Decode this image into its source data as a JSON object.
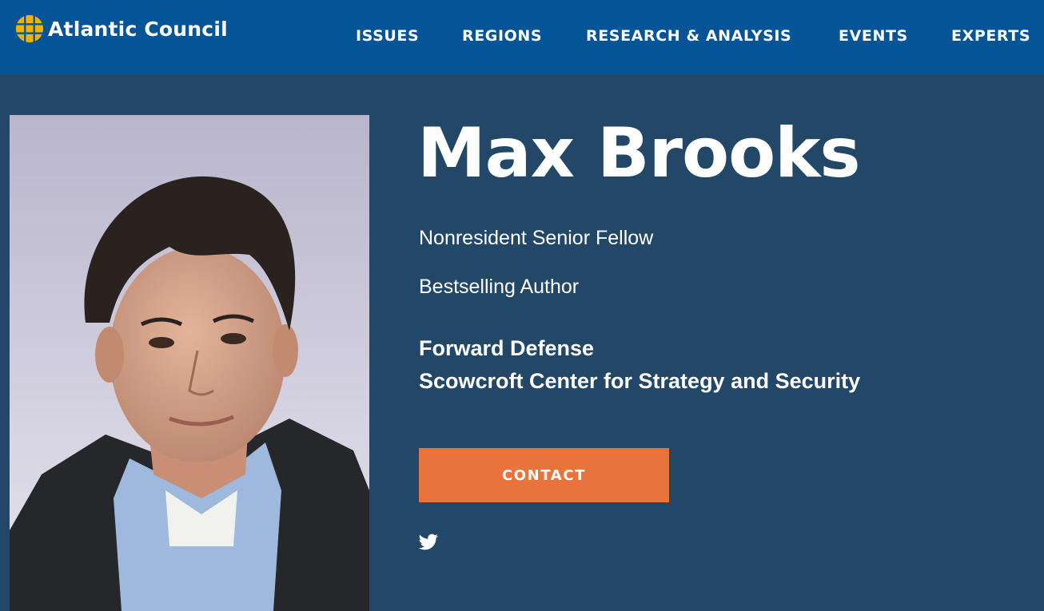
{
  "header": {
    "logo_text": "Atlantic Council",
    "logo_icon": "globe-icon",
    "nav": [
      {
        "label": "ISSUES"
      },
      {
        "label": "REGIONS"
      },
      {
        "label": "RESEARCH & ANALYSIS"
      },
      {
        "label": "EVENTS"
      },
      {
        "label": "EXPERTS"
      }
    ]
  },
  "profile": {
    "name": "Max Brooks",
    "roles": [
      "Nonresident Senior Fellow",
      "Bestselling Author"
    ],
    "programs": [
      "Forward Defense",
      "Scowcroft Center for Strategy and Security"
    ],
    "contact_label": "CONTACT",
    "social_icon": "twitter-icon"
  },
  "colors": {
    "header_bg": "#045498",
    "page_bg": "#224767",
    "accent": "#e8743b",
    "logo_gold": "#f2b300"
  }
}
